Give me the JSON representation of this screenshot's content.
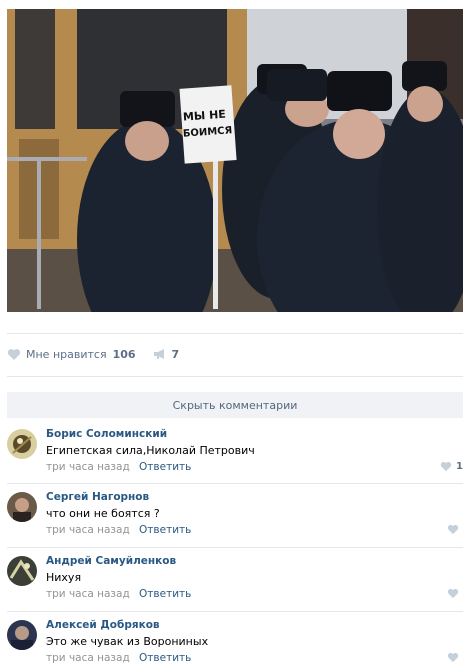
{
  "photo": {
    "sign_line1": "МЫ НЕ",
    "sign_line2": "БОИМСЯ"
  },
  "post_actions": {
    "like_label": "Мне нравится",
    "like_count": "106",
    "share_count": "7"
  },
  "comments_toggle": "Скрыть комментарии",
  "comments": [
    {
      "author": "Борис Соломинский",
      "text": "Египетская сила,Николай Петрович",
      "time": "три часа назад",
      "reply": "Ответить",
      "likes": "1"
    },
    {
      "author": "Сергей Нагорнов",
      "text": "что они не боятся ?",
      "time": "три часа назад",
      "reply": "Ответить",
      "likes": ""
    },
    {
      "author": "Андрей Самуйленков",
      "text": "Нихуя",
      "time": "три часа назад",
      "reply": "Ответить",
      "likes": ""
    },
    {
      "author": "Алексей Добряков",
      "text": "Это же чувак из Ворониных",
      "time": "три часа назад",
      "reply": "Ответить",
      "likes": ""
    }
  ],
  "colors": {
    "link": "#2a5885",
    "muted": "#939393",
    "icon": "#c5d0db"
  }
}
